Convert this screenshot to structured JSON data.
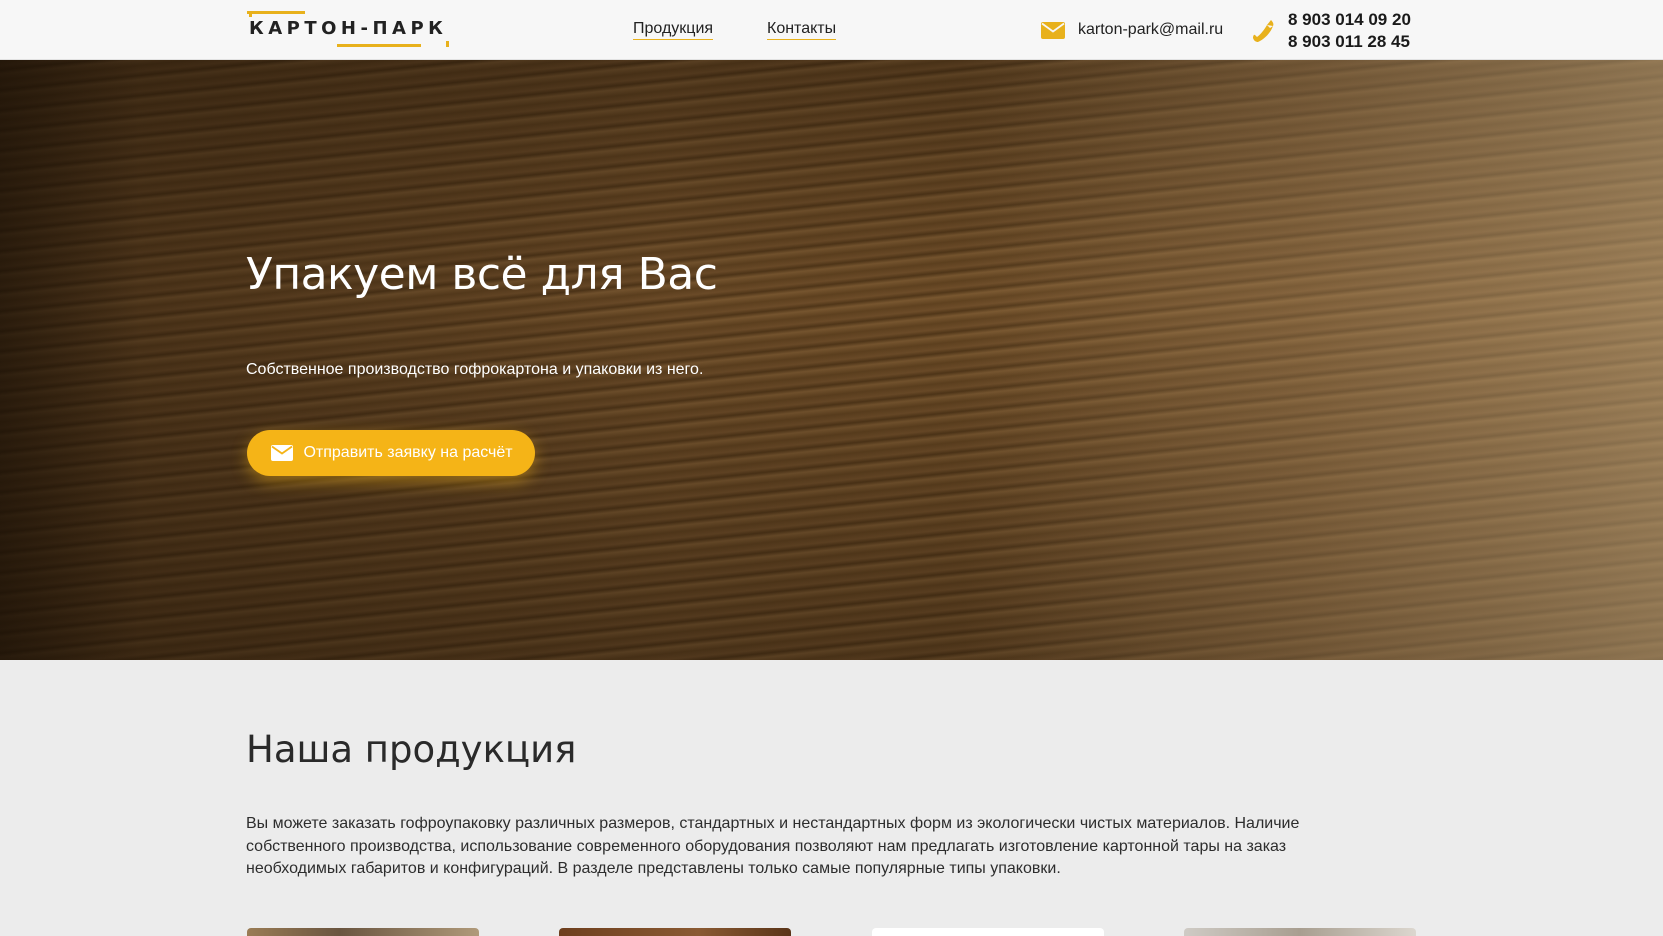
{
  "header": {
    "logo_text": "КАРТОН-ПАРК",
    "nav": [
      {
        "label": "Продукция"
      },
      {
        "label": "Контакты"
      }
    ],
    "email": "karton-park@mail.ru",
    "phones": [
      "8 903 014 09 20",
      "8 903 011 28 45"
    ],
    "icons": {
      "email": "mail-icon",
      "phone": "phone-icon"
    }
  },
  "hero": {
    "title": "Упакуем всё для Вас",
    "subtitle": "Собственное производство гофрокартона и упаковки из него.",
    "cta_label": "Отправить заявку на расчёт",
    "cta_icon": "mail-icon"
  },
  "products": {
    "title": "Наша продукция",
    "description": "Вы можете заказать гофроупаковку различных размеров, стандартных и нестандартных форм из экологически чистых материалов. Наличие собственного производства, использование современного оборудования позволяют нам предлагать изготовление картонной тары на заказ необходимых габаритов и конфигураций. В разделе представлены только самые популярные типы упаковки."
  },
  "colors": {
    "accent": "#f5b417",
    "logo_accent": "#e8b11c",
    "header_bg": "#f7f7f7",
    "section_bg": "#ececec"
  }
}
